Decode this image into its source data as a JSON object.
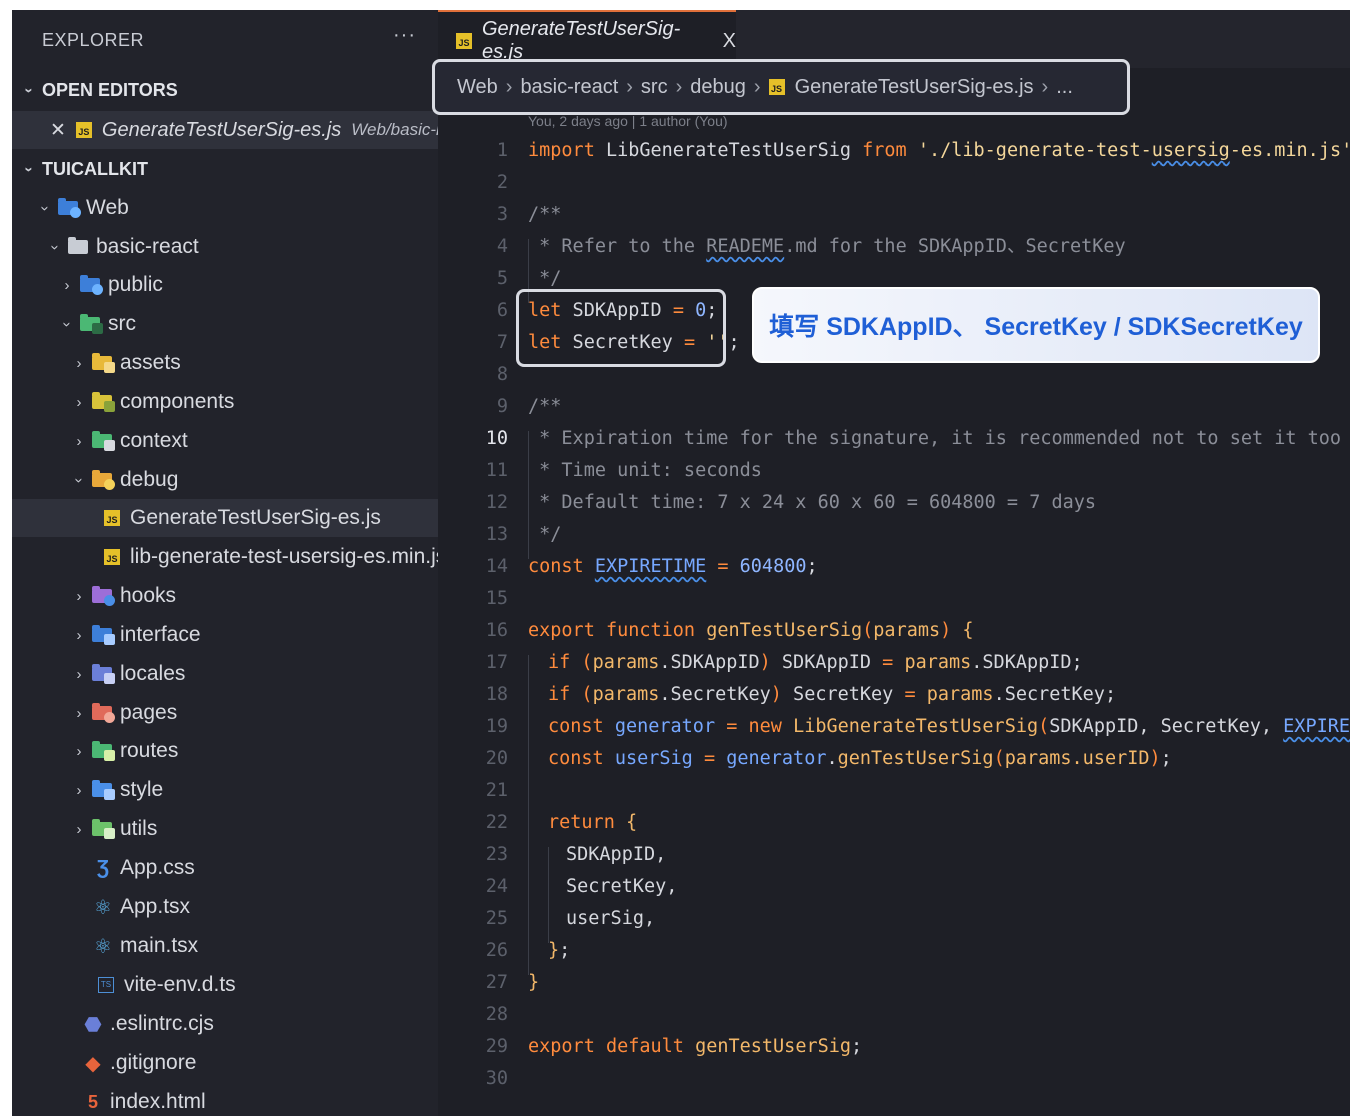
{
  "sidebar": {
    "title": "EXPLORER",
    "more": "···",
    "open_editors": {
      "label": "OPEN EDITORS",
      "file": "GenerateTestUserSig-es.js",
      "path": "Web/basic-r..."
    },
    "project": {
      "label": "TUICALLKIT"
    },
    "tree": {
      "web": "Web",
      "basic_react": "basic-react",
      "public": "public",
      "src": "src",
      "assets": "assets",
      "components": "components",
      "context": "context",
      "debug": "debug",
      "gen_file": "GenerateTestUserSig-es.js",
      "lib_file": "lib-generate-test-usersig-es.min.js",
      "hooks": "hooks",
      "interface": "interface",
      "locales": "locales",
      "pages": "pages",
      "routes": "routes",
      "style": "style",
      "utils": "utils",
      "app_css": "App.css",
      "app_tsx": "App.tsx",
      "main_tsx": "main.tsx",
      "vite_env": "vite-env.d.ts",
      "eslintrc": ".eslintrc.cjs",
      "gitignore": ".gitignore",
      "index_html": "index.html"
    }
  },
  "editor": {
    "tab": {
      "label": "GenerateTestUserSig-es.js",
      "close": "X"
    },
    "breadcrumb": {
      "web": "Web",
      "basic_react": "basic-react",
      "src": "src",
      "debug": "debug",
      "file": "GenerateTestUserSig-es.js",
      "more": "..."
    },
    "blame": "You, 2 days ago | 1 author (You)",
    "callout": "填写 SDKAppID、 SecretKey / SDKSecretKey",
    "current_line": "10",
    "code": {
      "l1": {
        "kw": "import",
        "name": " LibGenerateTestUserSig ",
        "from": "from",
        "s1": " './lib-generate-test-",
        "s2": "usersig",
        "s3": "-es.min.js'",
        "end": ";"
      },
      "l3": "/**",
      "l4": {
        "a": " * Refer to the ",
        "b": "READEME",
        "c": ".md for the SDKAppID、SecretKey"
      },
      "l5": " */",
      "l6": {
        "kw": "let",
        "name": " SDKAppID ",
        "op": "= ",
        "val": "0",
        "end": ";"
      },
      "l7": {
        "kw": "let",
        "name": " SecretKey ",
        "op": "= ",
        "val": "''",
        "end": ";"
      },
      "l9": "/**",
      "l10": " * Expiration time for the signature, it is recommended not to set it too short.",
      "l11": " * Time unit: seconds",
      "l12": " * Default time: 7 x 24 x 60 x 60 = 604800 = 7 days",
      "l13": " */",
      "l14": {
        "kw": "const",
        "sp": " ",
        "name": "EXPIRETIME",
        "op": " = ",
        "val": "604800",
        "end": ";"
      },
      "l16": {
        "kw1": "export",
        "kw2": " function",
        "fn": " genTestUserSig",
        "p1": "(",
        "param": "params",
        "p2": ")",
        "brace": " {"
      },
      "l17": {
        "kw": "if",
        "p1": " (",
        "a": "params",
        "b": ".SDKAppID",
        "p2": ")",
        "c": " SDKAppID ",
        "op": "=",
        "d": " params",
        "e": ".SDKAppID;"
      },
      "l18": {
        "kw": "if",
        "p1": " (",
        "a": "params",
        "b": ".SecretKey",
        "p2": ")",
        "c": " SecretKey ",
        "op": "=",
        "d": " params",
        "e": ".SecretKey;"
      },
      "l19": {
        "kw": "const",
        "v": " generator",
        "op": " =",
        "kw2": " new",
        "cls": " LibGenerateTestUserSig",
        "p1": "(",
        "args": "SDKAppID, SecretKey, ",
        "arg3": "EXPIRETIME",
        "p2": ")",
        "end": ";"
      },
      "l20": {
        "kw": "const",
        "v": " userSig",
        "op": " =",
        "a": " generator",
        "b": ".",
        "fn": "genTestUserSig",
        "p1": "(",
        "c": "params.userID",
        "p2": ")",
        "end": ";"
      },
      "l22": {
        "kw": "return",
        "brace": " {"
      },
      "l23": "SDKAppID,",
      "l24": "SecretKey,",
      "l25": "userSig,",
      "l26": {
        "brace": "}",
        "end": ";"
      },
      "l27": "}",
      "l29": {
        "kw1": "export",
        "kw2": " default",
        "fn": " genTestUserSig",
        "end": ";"
      }
    }
  },
  "line_numbers": [
    "1",
    "2",
    "3",
    "4",
    "5",
    "6",
    "7",
    "8",
    "9",
    "10",
    "11",
    "12",
    "13",
    "14",
    "15",
    "16",
    "17",
    "18",
    "19",
    "20",
    "21",
    "22",
    "23",
    "24",
    "25",
    "26",
    "27",
    "28",
    "29",
    "30"
  ],
  "colors": {
    "keyword": "#ff8b3d",
    "function": "#f3b86a",
    "string": "#f4d79b",
    "number": "#8fb6ff",
    "comment": "#8b8e98",
    "callout_text": "#1f5fd6",
    "tab_accent": "#e0703a"
  }
}
